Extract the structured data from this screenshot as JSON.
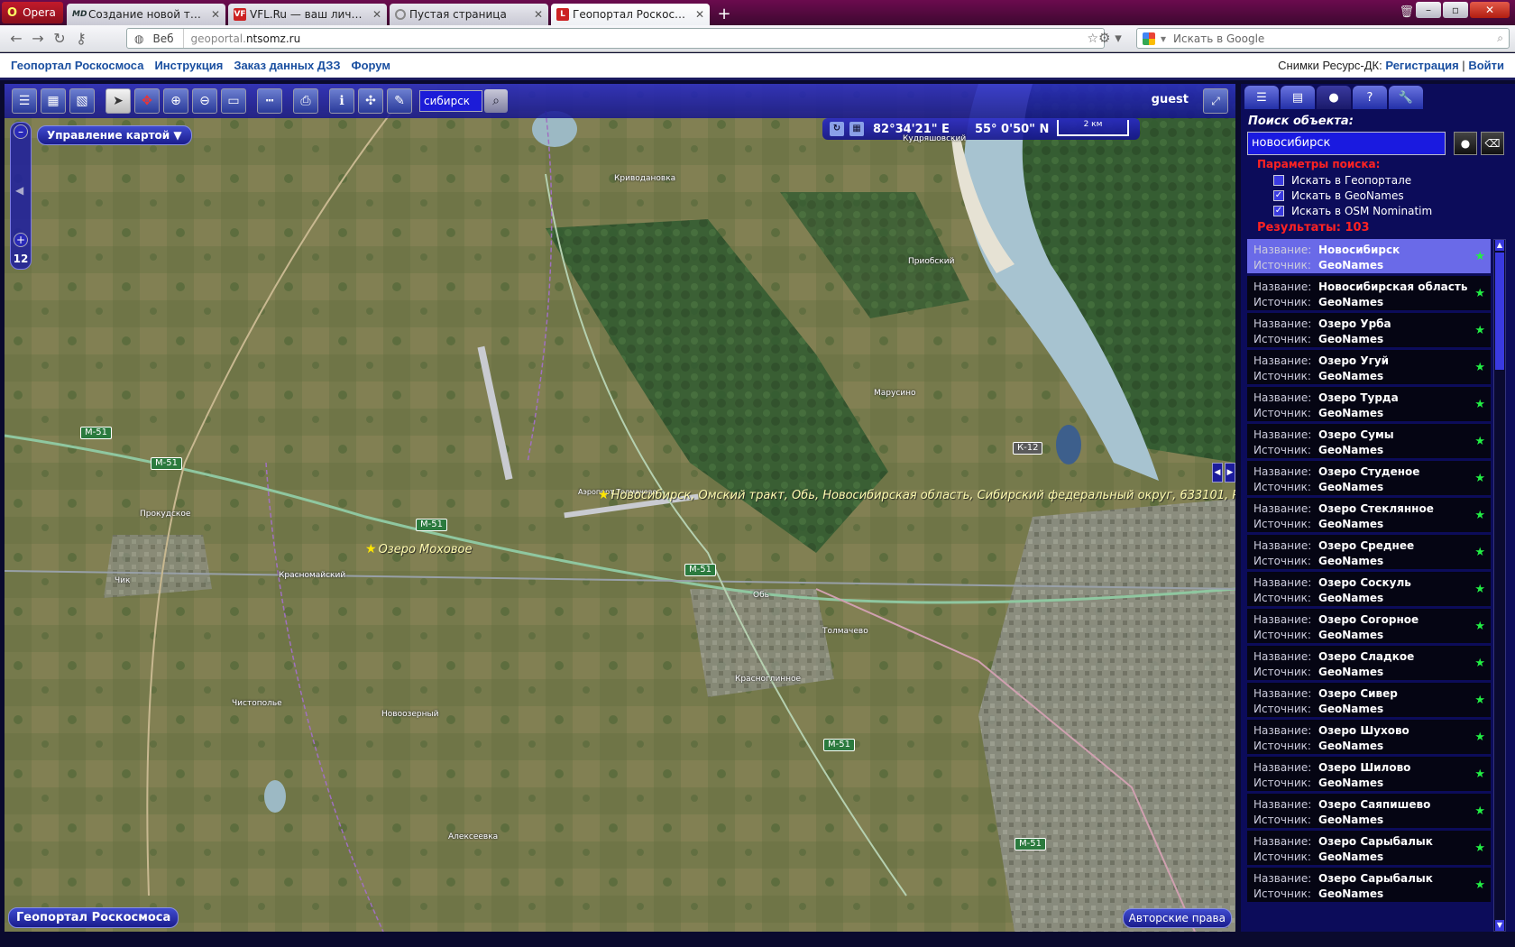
{
  "browser": {
    "menu_label": "Opera",
    "tabs": [
      {
        "icon": "MD",
        "label": "Создание новой темы..."
      },
      {
        "icon": "VF",
        "label": "VFL.Ru — ваш личны..."
      },
      {
        "icon": "",
        "label": "Пустая страница"
      },
      {
        "icon": "",
        "label": "Геопортал Роскосмоса"
      }
    ],
    "web_label": "Веб",
    "url_prefix": "geoportal.",
    "url_domain": "ntsomz.ru",
    "search_placeholder": "Искать в Google"
  },
  "sitenav": {
    "links": [
      "Геопортал Роскосмоса",
      "Инструкция",
      "Заказ данных ДЗЗ",
      "Форум"
    ],
    "right_text": "Снимки Ресурс-ДК:",
    "register": "Регистрация",
    "separator": "|",
    "login": "Войти"
  },
  "map": {
    "search_value": "сибирск",
    "user": "guest",
    "menu_label": "Управление картой",
    "zoom_level": "12",
    "coord_lon": "82°34'21\" E",
    "coord_lat": "55° 0'50\" N",
    "scale_label": "2 км",
    "footer_left": "Геопортал Роскосмоса",
    "footer_right": "Авторские права",
    "labels": [
      "Кудряшовский",
      "Криводановка",
      "Приобский",
      "Марусино",
      "Прокудское",
      "Красномайский",
      "Чик",
      "Обь",
      "Толмачево",
      "Красноглинное",
      "Чистополье",
      "Новоозерный",
      "Алексеевка",
      "Аэропорт Толмачево"
    ],
    "roads": [
      "М-51",
      "М-51",
      "М-51",
      "М-51",
      "М-51",
      "М-51",
      "К-12"
    ],
    "markers": [
      {
        "label": "Новосибирск, Омский тракт, Обь, Новосибирская область, Сибирский федеральный округ, 633101, Рос"
      },
      {
        "label": "Озеро Моховое"
      }
    ]
  },
  "panel": {
    "title": "Поиск объекта:",
    "search_value": "новосибирск",
    "params_title": "Параметры поиска:",
    "options": [
      {
        "label": "Искать в Геопортале",
        "checked": false
      },
      {
        "label": "Искать в GeoNames",
        "checked": true
      },
      {
        "label": "Искать в OSM Nominatim",
        "checked": true
      }
    ],
    "results_label": "Результаты:",
    "results_count": "103",
    "name_key": "Название:",
    "source_key": "Источник:",
    "items": [
      {
        "name": "Новосибирск",
        "source": "GeoNames"
      },
      {
        "name": "Новосибирская область",
        "source": "GeoNames"
      },
      {
        "name": "Озеро Урба",
        "source": "GeoNames"
      },
      {
        "name": "Озеро Угуй",
        "source": "GeoNames"
      },
      {
        "name": "Озеро Турда",
        "source": "GeoNames"
      },
      {
        "name": "Озеро Сумы",
        "source": "GeoNames"
      },
      {
        "name": "Озеро Студеное",
        "source": "GeoNames"
      },
      {
        "name": "Озеро Стеклянное",
        "source": "GeoNames"
      },
      {
        "name": "Озеро Среднее",
        "source": "GeoNames"
      },
      {
        "name": "Озеро Соскуль",
        "source": "GeoNames"
      },
      {
        "name": "Озеро Согорное",
        "source": "GeoNames"
      },
      {
        "name": "Озеро Сладкое",
        "source": "GeoNames"
      },
      {
        "name": "Озеро Сивер",
        "source": "GeoNames"
      },
      {
        "name": "Озеро Шухово",
        "source": "GeoNames"
      },
      {
        "name": "Озеро Шилово",
        "source": "GeoNames"
      },
      {
        "name": "Озеро Саяпишево",
        "source": "GeoNames"
      },
      {
        "name": "Озеро Сарыбалык",
        "source": "GeoNames"
      },
      {
        "name": "Озеро Сарыбалык",
        "source": "GeoNames"
      }
    ]
  }
}
